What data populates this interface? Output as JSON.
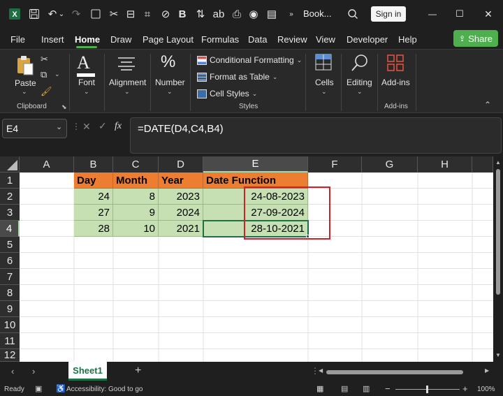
{
  "titlebar": {
    "app_icon": "excel-logo-icon",
    "document_title": "Book...",
    "sign_in_label": "Sign in",
    "minimize_glyph": "—",
    "maximize_glyph": "☐",
    "close_glyph": "✕"
  },
  "menubar": {
    "tabs": [
      "File",
      "Insert",
      "Home",
      "Draw",
      "Page Layout",
      "Formulas",
      "Data",
      "Review",
      "View",
      "Developer",
      "Help"
    ],
    "active_tab": "Home",
    "share_label": "Share"
  },
  "ribbon": {
    "clipboard": {
      "paste_label": "Paste",
      "group_label": "Clipboard"
    },
    "font": {
      "label": "Font"
    },
    "alignment": {
      "label": "Alignment"
    },
    "number": {
      "label": "Number"
    },
    "styles": {
      "conditional_formatting": "Conditional Formatting",
      "format_as_table": "Format as Table",
      "cell_styles": "Cell Styles",
      "group_label": "Styles"
    },
    "cells": {
      "label": "Cells"
    },
    "editing": {
      "label": "Editing"
    },
    "addins": {
      "label": "Add-ins",
      "group_label": "Add-ins"
    }
  },
  "formula_bar": {
    "name_box": "E4",
    "fx": "fx",
    "formula": "=DATE(D4,C4,B4)"
  },
  "grid": {
    "columns": [
      "A",
      "B",
      "C",
      "D",
      "E",
      "F",
      "G",
      "H"
    ],
    "rows": [
      "1",
      "2",
      "3",
      "4",
      "5",
      "6",
      "7",
      "8",
      "9",
      "10",
      "11",
      "12"
    ],
    "selected_column": "E",
    "selected_row": "4",
    "header_row": [
      "Day",
      "Month",
      "Year",
      "Date Function"
    ],
    "data": [
      [
        "24",
        "8",
        "2023",
        "24-08-2023"
      ],
      [
        "27",
        "9",
        "2024",
        "27-09-2024"
      ],
      [
        "28",
        "10",
        "2021",
        "28-10-2021"
      ]
    ]
  },
  "colors": {
    "header_fill": "#ED7D31",
    "data_fill": "#C6E0B4",
    "highlight_border": "#D0202A",
    "active_tab_underline": "#4FAF4F"
  },
  "sheets": {
    "tabs": [
      "Sheet1"
    ],
    "active": "Sheet1"
  },
  "status": {
    "ready": "Ready",
    "accessibility": "Accessibility: Good to go",
    "zoom": "100%"
  }
}
